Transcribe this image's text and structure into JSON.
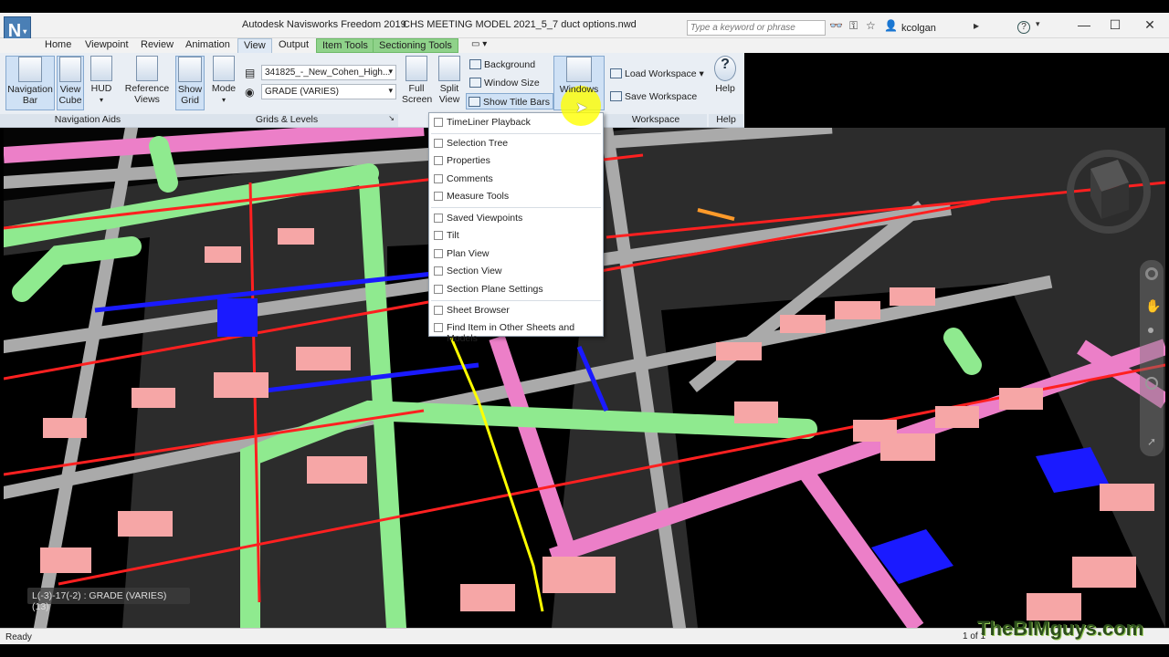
{
  "window": {
    "app_title": "Autodesk Navisworks Freedom 2019",
    "file_title": "CHS MEETING MODEL 2021_5_7 duct options.nwd",
    "search_placeholder": "Type a keyword or phrase",
    "user": "kcolgan",
    "help_icon": "?",
    "minimize": "—",
    "maximize": "☐",
    "close": "✕"
  },
  "tabs": [
    {
      "label": "Home"
    },
    {
      "label": "Viewpoint"
    },
    {
      "label": "Review"
    },
    {
      "label": "Animation"
    },
    {
      "label": "View"
    },
    {
      "label": "Output"
    },
    {
      "label": "Item Tools"
    },
    {
      "label": "Sectioning Tools"
    }
  ],
  "ribbon": {
    "navigation_aids": {
      "label": "Navigation Aids",
      "nav_bar": "Navigation\nBar",
      "view_cube": "View\nCube",
      "hud": "HUD",
      "reference_views": "Reference\nViews"
    },
    "grids_levels": {
      "label": "Grids & Levels",
      "show_grid": "Show\nGrid",
      "mode": "Mode",
      "level_combo": "341825_-_New_Cohen_High...",
      "grade_combo": "GRADE (VARIES)"
    },
    "scene": {
      "full_screen": "Full\nScreen",
      "split_view": "Split\nView",
      "background": "Background",
      "window_size": "Window Size",
      "show_title_bars": "Show Title Bars",
      "windows": "Windows"
    },
    "workspace": {
      "label": "Workspace",
      "load": "Load Workspace",
      "save": "Save Workspace"
    },
    "help": {
      "label": "Help",
      "button": "Help"
    }
  },
  "windows_menu": {
    "items": [
      {
        "label": "TimeLiner Playback"
      },
      {
        "label": "Selection Tree"
      },
      {
        "label": "Properties"
      },
      {
        "label": "Comments"
      },
      {
        "label": "Measure Tools"
      },
      {
        "label": "Saved Viewpoints"
      },
      {
        "label": "Tilt"
      },
      {
        "label": "Plan View"
      },
      {
        "label": "Section View"
      },
      {
        "label": "Section Plane Settings"
      },
      {
        "label": "Sheet Browser"
      },
      {
        "label": "Find Item in Other Sheets and Models"
      }
    ]
  },
  "viewport": {
    "grid_location": "L(-3)-17(-2) : GRADE (VARIES) (13)"
  },
  "status": {
    "text": "Ready",
    "page": "1 of 1"
  },
  "watermark": "TheBIMguys.com",
  "colors": {
    "ribbon_bg": "#e9eef4",
    "highlight": "#ffff00",
    "duct_green": "#8fea8f",
    "duct_pink": "#ec7fc8",
    "pipe_red": "#ff2020",
    "pipe_blue": "#1a1aff"
  }
}
